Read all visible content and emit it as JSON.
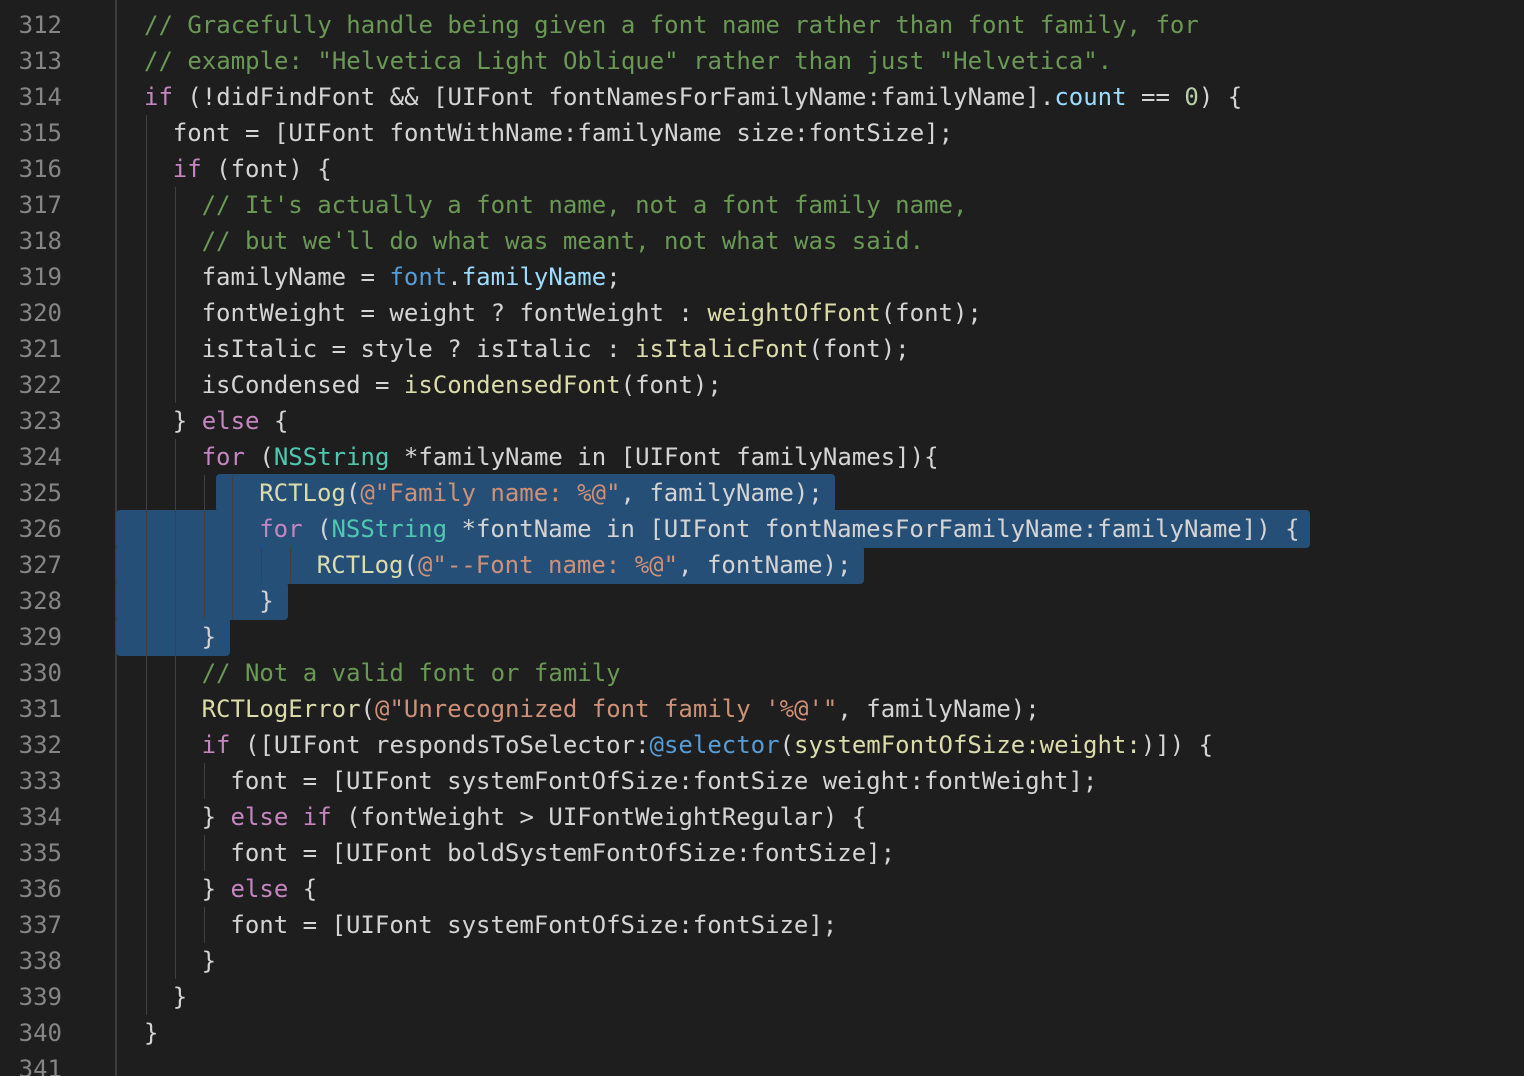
{
  "editor": {
    "language": "objective-c",
    "colors": {
      "background": "#1e1e1e",
      "line_number": "#858585",
      "comment": "#6a9955",
      "keyword": "#c586c0",
      "function": "#dcdcaa",
      "string": "#ce9178",
      "type": "#4ec9b0",
      "property": "#9cdcfe",
      "builtin": "#569cd6",
      "number": "#b5cea8",
      "selection": "#264f78"
    },
    "selected_lines": [
      325,
      329
    ],
    "lines": [
      {
        "n": "312",
        "indent": 0,
        "tokens": [
          [
            "c",
            "// Gracefully handle being given a font name rather than font family, for"
          ]
        ]
      },
      {
        "n": "313",
        "indent": 0,
        "tokens": [
          [
            "c",
            "// example: \"Helvetica Light Oblique\" rather than just \"Helvetica\"."
          ]
        ]
      },
      {
        "n": "314",
        "indent": 0,
        "tokens": [
          [
            "k",
            "if"
          ],
          [
            "",
            " (!didFindFont && [UIFont fontNamesForFamilyName:familyName]."
          ],
          [
            "p",
            "count"
          ],
          [
            "",
            " == "
          ],
          [
            "n",
            "0"
          ],
          [
            "",
            ") {"
          ]
        ]
      },
      {
        "n": "315",
        "indent": 1,
        "tokens": [
          [
            "",
            "font = [UIFont fontWithName:familyName size:fontSize];"
          ]
        ]
      },
      {
        "n": "316",
        "indent": 1,
        "tokens": [
          [
            "k",
            "if"
          ],
          [
            "",
            " (font) {"
          ]
        ]
      },
      {
        "n": "317",
        "indent": 2,
        "tokens": [
          [
            "c",
            "// It's actually a font name, not a font family name,"
          ]
        ]
      },
      {
        "n": "318",
        "indent": 2,
        "tokens": [
          [
            "c",
            "// but we'll do what was meant, not what was said."
          ]
        ]
      },
      {
        "n": "319",
        "indent": 2,
        "tokens": [
          [
            "",
            "familyName = "
          ],
          [
            "b",
            "font"
          ],
          [
            "",
            "."
          ],
          [
            "p",
            "familyName"
          ],
          [
            "",
            ";"
          ]
        ]
      },
      {
        "n": "320",
        "indent": 2,
        "tokens": [
          [
            "",
            "fontWeight = weight ? fontWeight : "
          ],
          [
            "f",
            "weightOfFont"
          ],
          [
            "",
            "(font);"
          ]
        ]
      },
      {
        "n": "321",
        "indent": 2,
        "tokens": [
          [
            "",
            "isItalic = style ? isItalic : "
          ],
          [
            "f",
            "isItalicFont"
          ],
          [
            "",
            "(font);"
          ]
        ]
      },
      {
        "n": "322",
        "indent": 2,
        "tokens": [
          [
            "",
            "isCondensed = "
          ],
          [
            "f",
            "isCondensedFont"
          ],
          [
            "",
            "(font);"
          ]
        ]
      },
      {
        "n": "323",
        "indent": 1,
        "tokens": [
          [
            "",
            "} "
          ],
          [
            "k",
            "else"
          ],
          [
            "",
            " {"
          ]
        ]
      },
      {
        "n": "324",
        "indent": 2,
        "tokens": [
          [
            "k",
            "for"
          ],
          [
            "",
            " ("
          ],
          [
            "t",
            "NSString"
          ],
          [
            "",
            " *familyName in [UIFont familyNames]){"
          ]
        ]
      },
      {
        "n": "325",
        "indent": 4,
        "tokens": [
          [
            "f",
            "RCTLog"
          ],
          [
            "",
            "("
          ],
          [
            "s",
            "@\"Family name: %@\""
          ],
          [
            "",
            ", familyName);"
          ]
        ]
      },
      {
        "n": "326",
        "indent": 4,
        "tokens": [
          [
            "k",
            "for"
          ],
          [
            "",
            " ("
          ],
          [
            "t",
            "NSString"
          ],
          [
            "",
            " *fontName in [UIFont fontNamesForFamilyName:familyName]) {"
          ]
        ]
      },
      {
        "n": "327",
        "indent": 6,
        "tokens": [
          [
            "f",
            "RCTLog"
          ],
          [
            "",
            "("
          ],
          [
            "s",
            "@\"--Font name: %@\""
          ],
          [
            "",
            ", fontName);"
          ]
        ]
      },
      {
        "n": "328",
        "indent": 4,
        "tokens": [
          [
            "",
            "}"
          ]
        ]
      },
      {
        "n": "329",
        "indent": 2,
        "tokens": [
          [
            "",
            "}"
          ]
        ]
      },
      {
        "n": "330",
        "indent": 2,
        "tokens": [
          [
            "c",
            "// Not a valid font or family"
          ]
        ]
      },
      {
        "n": "331",
        "indent": 2,
        "tokens": [
          [
            "f",
            "RCTLogError"
          ],
          [
            "",
            "("
          ],
          [
            "s",
            "@\"Unrecognized font family '%@'\""
          ],
          [
            "",
            ", familyName);"
          ]
        ]
      },
      {
        "n": "332",
        "indent": 2,
        "tokens": [
          [
            "k",
            "if"
          ],
          [
            "",
            " ([UIFont respondsToSelector:"
          ],
          [
            "b",
            "@selector"
          ],
          [
            "",
            "("
          ],
          [
            "f",
            "systemFontOfSize:weight:"
          ],
          [
            "",
            ")]) {"
          ]
        ]
      },
      {
        "n": "333",
        "indent": 3,
        "tokens": [
          [
            "",
            "font = [UIFont systemFontOfSize:fontSize weight:fontWeight];"
          ]
        ]
      },
      {
        "n": "334",
        "indent": 2,
        "tokens": [
          [
            "",
            "} "
          ],
          [
            "k",
            "else if"
          ],
          [
            "",
            " (fontWeight > UIFontWeightRegular) {"
          ]
        ]
      },
      {
        "n": "335",
        "indent": 3,
        "tokens": [
          [
            "",
            "font = [UIFont boldSystemFontOfSize:fontSize];"
          ]
        ]
      },
      {
        "n": "336",
        "indent": 2,
        "tokens": [
          [
            "",
            "} "
          ],
          [
            "k",
            "else"
          ],
          [
            "",
            " {"
          ]
        ]
      },
      {
        "n": "337",
        "indent": 3,
        "tokens": [
          [
            "",
            "font = [UIFont systemFontOfSize:fontSize];"
          ]
        ]
      },
      {
        "n": "338",
        "indent": 2,
        "tokens": [
          [
            "",
            "}"
          ]
        ]
      },
      {
        "n": "339",
        "indent": 1,
        "tokens": [
          [
            "",
            "}"
          ]
        ]
      },
      {
        "n": "340",
        "indent": 0,
        "tokens": [
          [
            "",
            "}"
          ]
        ]
      },
      {
        "n": "341",
        "indent": 0,
        "tokens": []
      }
    ]
  }
}
